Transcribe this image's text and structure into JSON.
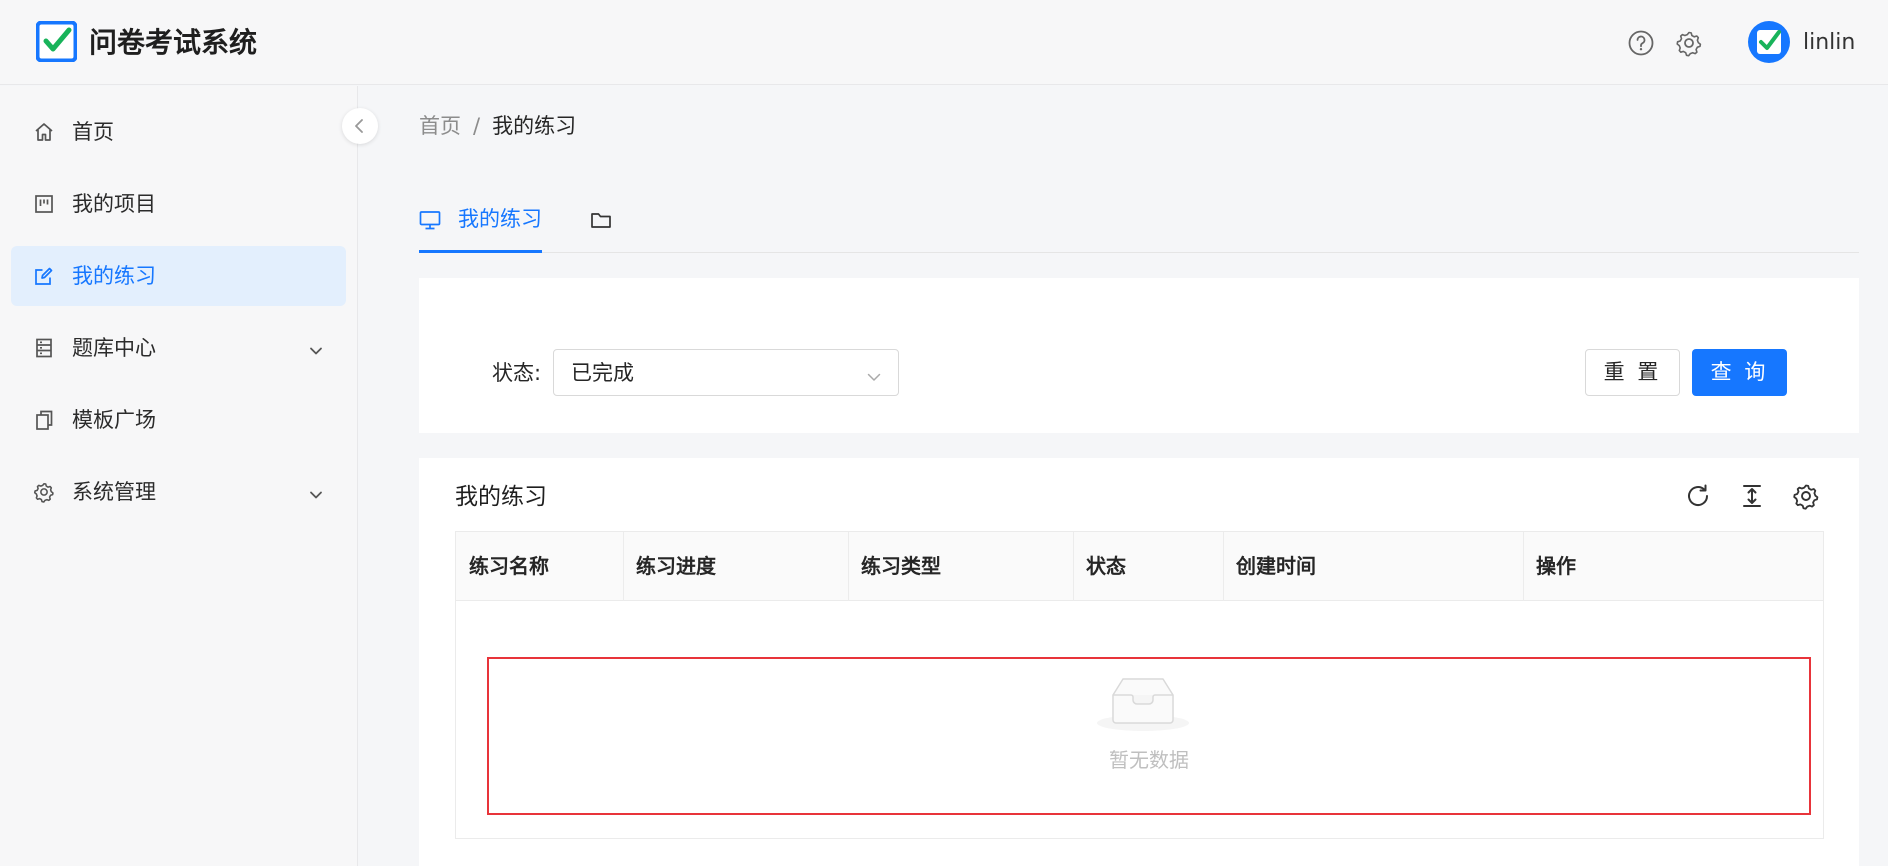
{
  "app": {
    "title": "问卷考试系统",
    "username": "linlin",
    "accent": "#1677ff"
  },
  "header_icons": [
    "help-icon",
    "gear-icon"
  ],
  "sidebar": {
    "items": [
      {
        "label": "首页",
        "icon": "home-icon",
        "active": false,
        "expandable": false
      },
      {
        "label": "我的项目",
        "icon": "project-icon",
        "active": false,
        "expandable": false
      },
      {
        "label": "我的练习",
        "icon": "edit-icon",
        "active": true,
        "expandable": false
      },
      {
        "label": "题库中心",
        "icon": "database-icon",
        "active": false,
        "expandable": true
      },
      {
        "label": "模板广场",
        "icon": "copy-icon",
        "active": false,
        "expandable": false
      },
      {
        "label": "系统管理",
        "icon": "gear-icon",
        "active": false,
        "expandable": true
      }
    ]
  },
  "breadcrumb": {
    "home": "首页",
    "separator": "/",
    "current": "我的练习"
  },
  "tabs": {
    "active_label": "我的练习"
  },
  "filter": {
    "status_label": "状态:",
    "status_value": "已完成",
    "reset_label": "重 置",
    "query_label": "查 询"
  },
  "table": {
    "title": "我的练习",
    "columns": [
      "练习名称",
      "练习进度",
      "练习类型",
      "状态",
      "创建时间",
      "操作"
    ],
    "empty_text": "暂无数据"
  }
}
